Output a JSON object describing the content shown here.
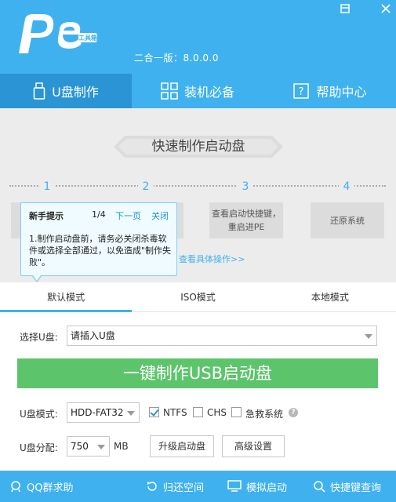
{
  "app": {
    "version": "二合一版：8.0.0.0"
  },
  "nav": {
    "tabs": [
      {
        "label": "U盘制作"
      },
      {
        "label": "装机必备"
      },
      {
        "label": "帮助中心"
      }
    ]
  },
  "main": {
    "title": "快速制作启动盘",
    "steps": [
      {
        "num": "1",
        "text": ""
      },
      {
        "num": "2",
        "text": ""
      },
      {
        "num": "3",
        "text": "查看启动快捷键，重启进PE"
      },
      {
        "num": "4",
        "text": "还原系统"
      }
    ],
    "detail_link": "查看具体操作>>",
    "tooltip": {
      "title": "新手提示",
      "page": "1/4",
      "next": "下一页",
      "close": "关闭",
      "body": "1.制作启动盘前，请务必关闭杀毒软件或选择全部通过，以免造成\"制作失败\"。"
    }
  },
  "modes": {
    "tabs": [
      {
        "label": "默认模式"
      },
      {
        "label": "ISO模式"
      },
      {
        "label": "本地模式"
      }
    ]
  },
  "form": {
    "select_label": "选择U盘:",
    "select_value": "请插入U盘",
    "make_button": "一键制作USB启动盘",
    "mode_label": "U盘模式:",
    "mode_value": "HDD-FAT32",
    "ntfs": "NTFS",
    "chs": "CHS",
    "rescue": "急救系统",
    "partition_label": "U盘分配:",
    "partition_value": "750",
    "partition_unit": "MB",
    "upgrade_button": "升级启动盘",
    "advanced_button": "高级设置"
  },
  "footer": {
    "items": [
      {
        "label": "QQ群求助"
      },
      {
        "label": "归还空间"
      },
      {
        "label": "模拟启动"
      },
      {
        "label": "快捷键查询"
      }
    ]
  },
  "colors": {
    "primary": "#3fb1ef",
    "active_tab": "#2a94d4",
    "make_button": "#5cc56b"
  }
}
